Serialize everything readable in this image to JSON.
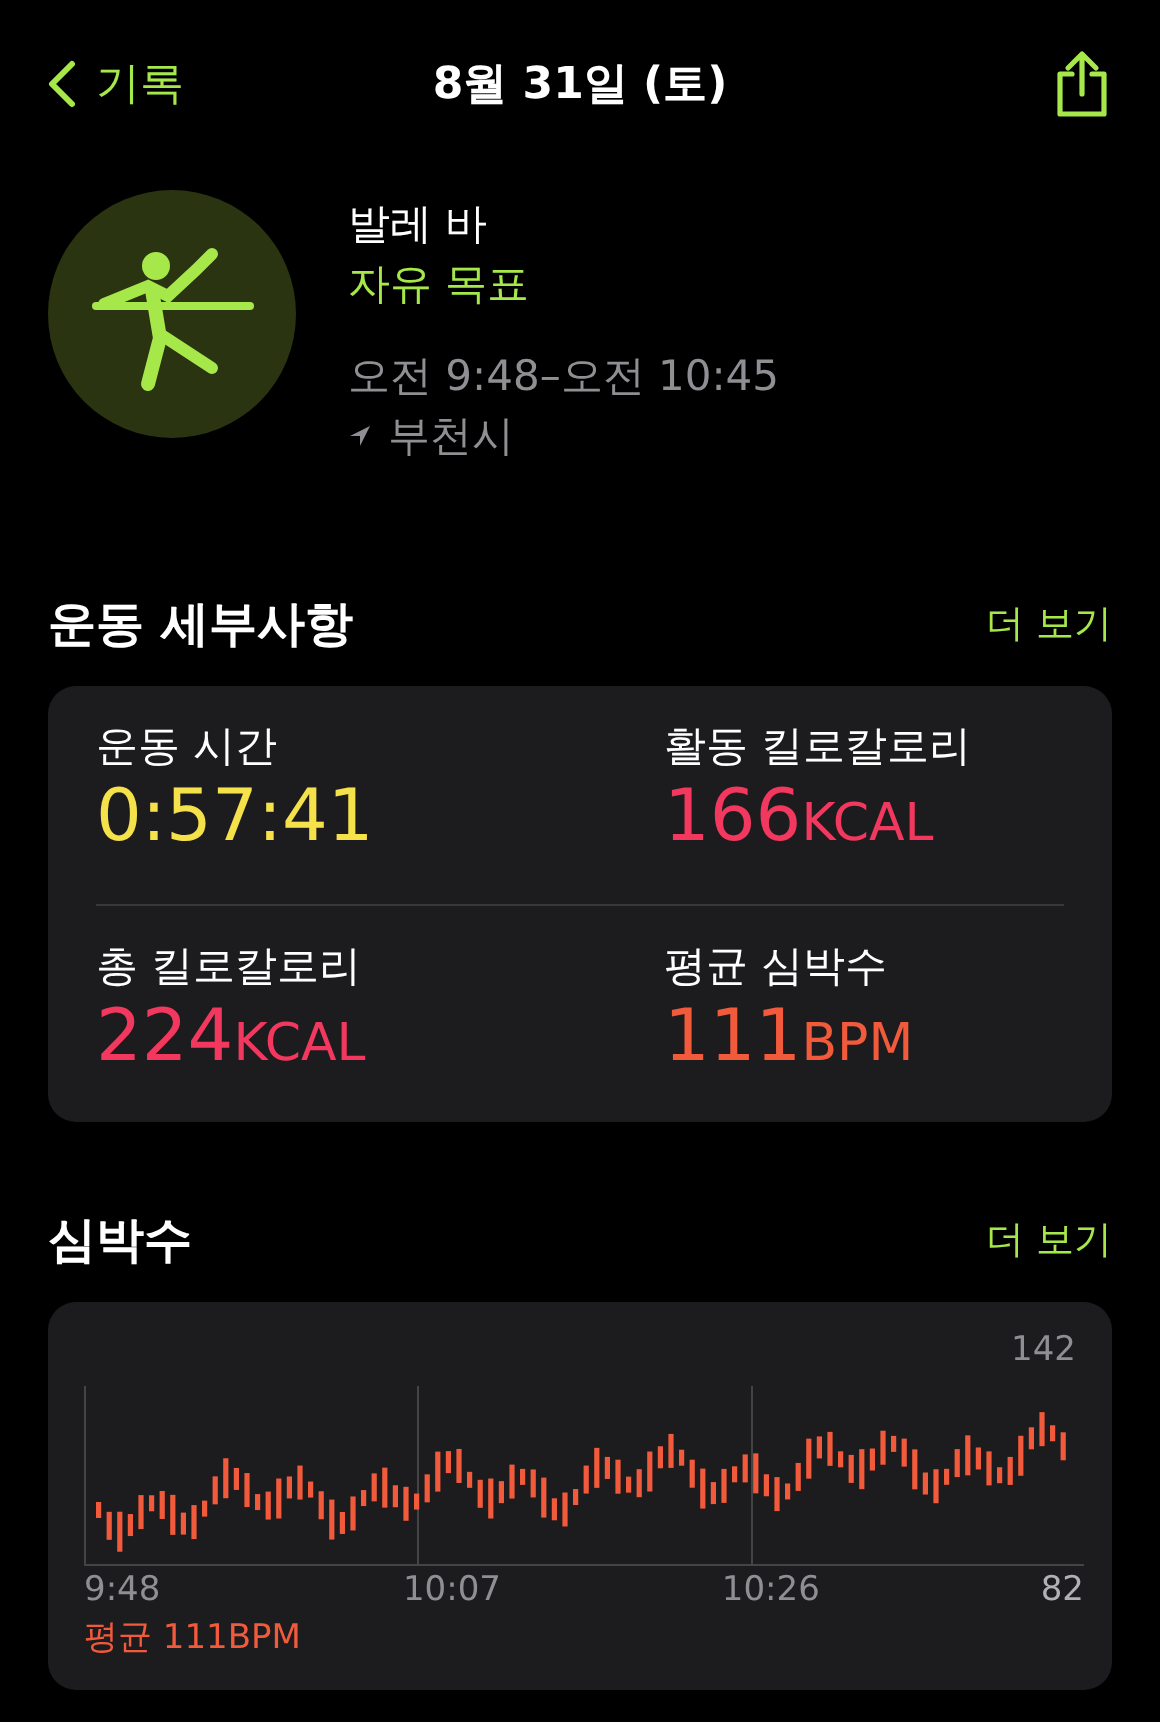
{
  "nav": {
    "back": "기록",
    "title": "8월 31일 (토)"
  },
  "workout": {
    "name": "발레 바",
    "goal": "자유 목표",
    "time": "오전 9:48–오전 10:45",
    "location": "부천시"
  },
  "details": {
    "title": "운동 세부사항",
    "more": "더 보기",
    "metrics": [
      {
        "label": "운동 시간",
        "value": "0:57:41",
        "color": "#f5e14a"
      },
      {
        "label": "활동 킬로칼로리",
        "value": "166",
        "unit": "KCAL",
        "color": "#f2385f"
      },
      {
        "label": "총 킬로칼로리",
        "value": "224",
        "unit": "KCAL",
        "color": "#f2385f"
      },
      {
        "label": "평균 심박수",
        "value": "111",
        "unit": "BPM",
        "color": "#f25a3c"
      }
    ]
  },
  "heart_rate": {
    "title": "심박수",
    "more": "더 보기",
    "max": "142",
    "min": "82",
    "times": [
      "9:48",
      "10:07",
      "10:26"
    ],
    "average": "평균 111BPM"
  }
}
